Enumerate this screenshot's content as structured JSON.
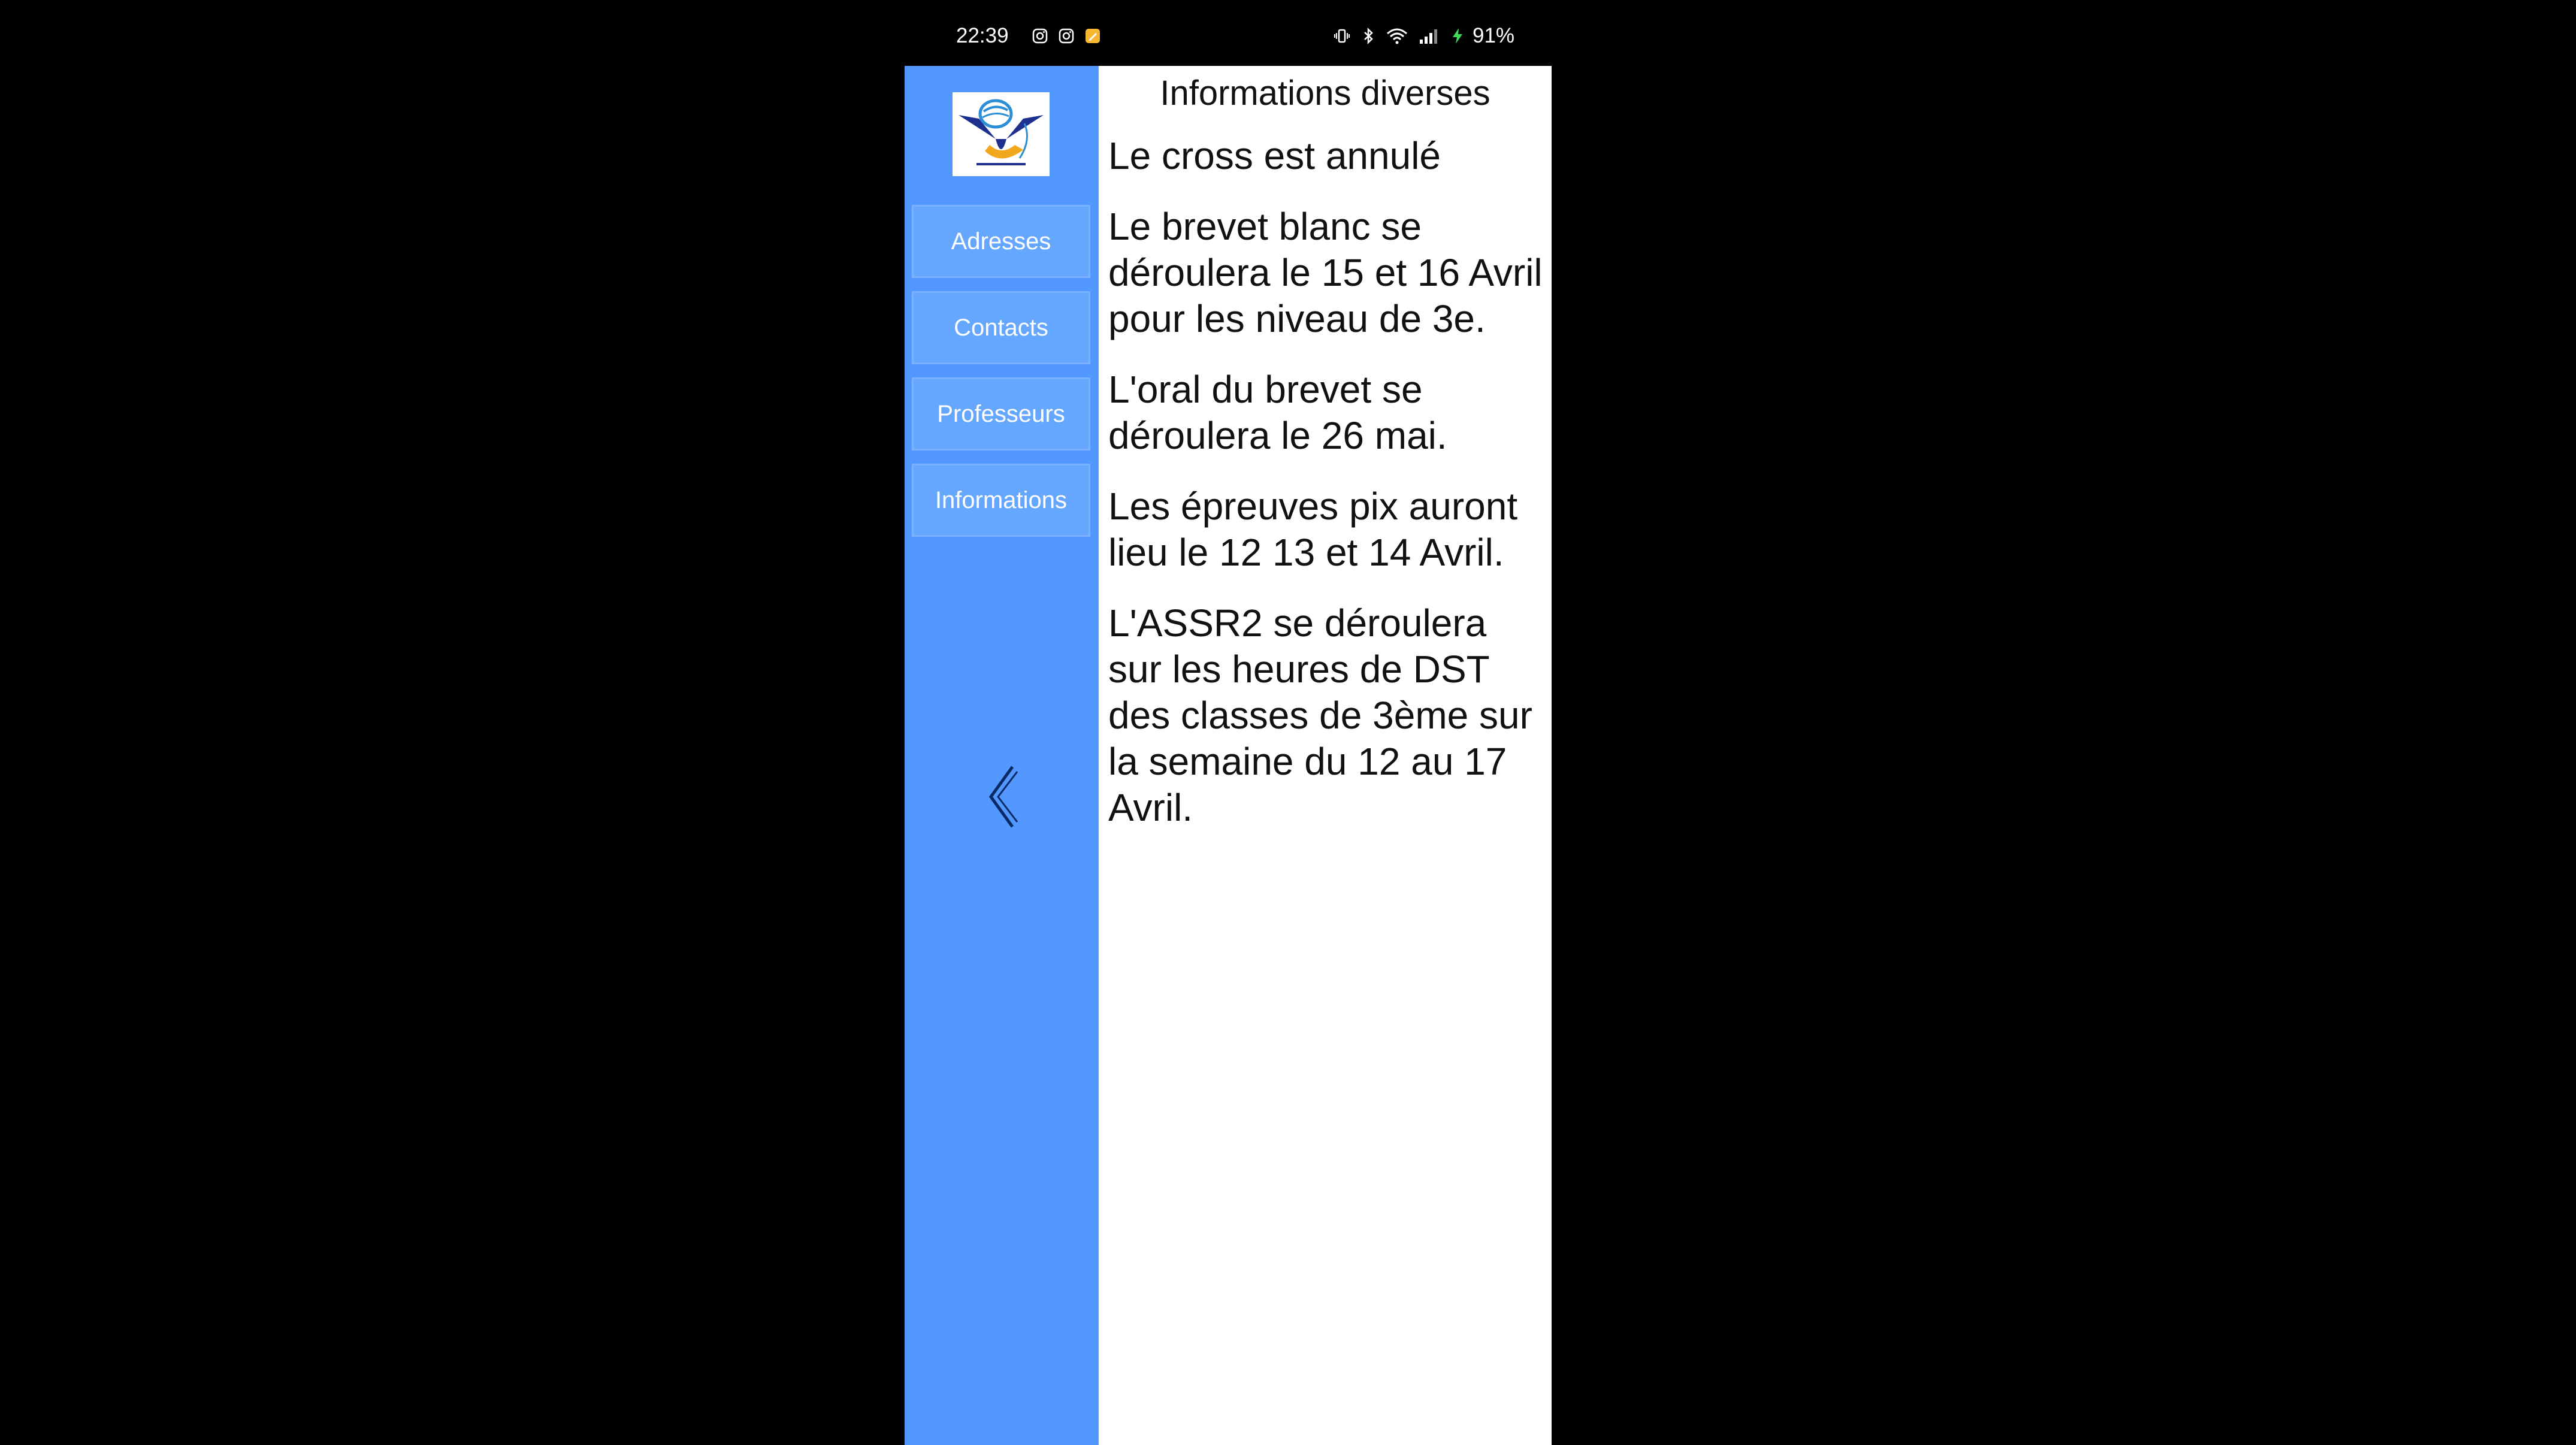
{
  "status_bar": {
    "time": "22:39",
    "notification_icons": [
      "instagram-icon",
      "instagram-icon",
      "notes-app-icon"
    ],
    "system_icons": [
      "vibrate-icon",
      "bluetooth-icon",
      "wifi-icon",
      "signal-icon",
      "charging-icon"
    ],
    "battery": "91%"
  },
  "sidebar": {
    "items": [
      {
        "label": "Adresses"
      },
      {
        "label": "Contacts"
      },
      {
        "label": "Professeurs"
      },
      {
        "label": "Informations"
      }
    ],
    "back_icon": "chevron-left-icon"
  },
  "main": {
    "title": "Informations diverses",
    "items": [
      "Le cross est annulé",
      "Le brevet blanc se déroulera le 15 et 16 Avril pour les niveau de 3e.",
      "L'oral du brevet se déroulera le 26 mai.",
      "Les épreuves pix auront lieu le 12 13 et 14 Avril.",
      "L'ASSR2 se déroulera sur les heures de DST des classes de 3ème sur la semaine du 12 au 17 Avril."
    ]
  },
  "colors": {
    "sidebar": "#5298fe",
    "nav_button": "#65a6fe",
    "content_bg": "#ffffff",
    "text": "#111111"
  }
}
